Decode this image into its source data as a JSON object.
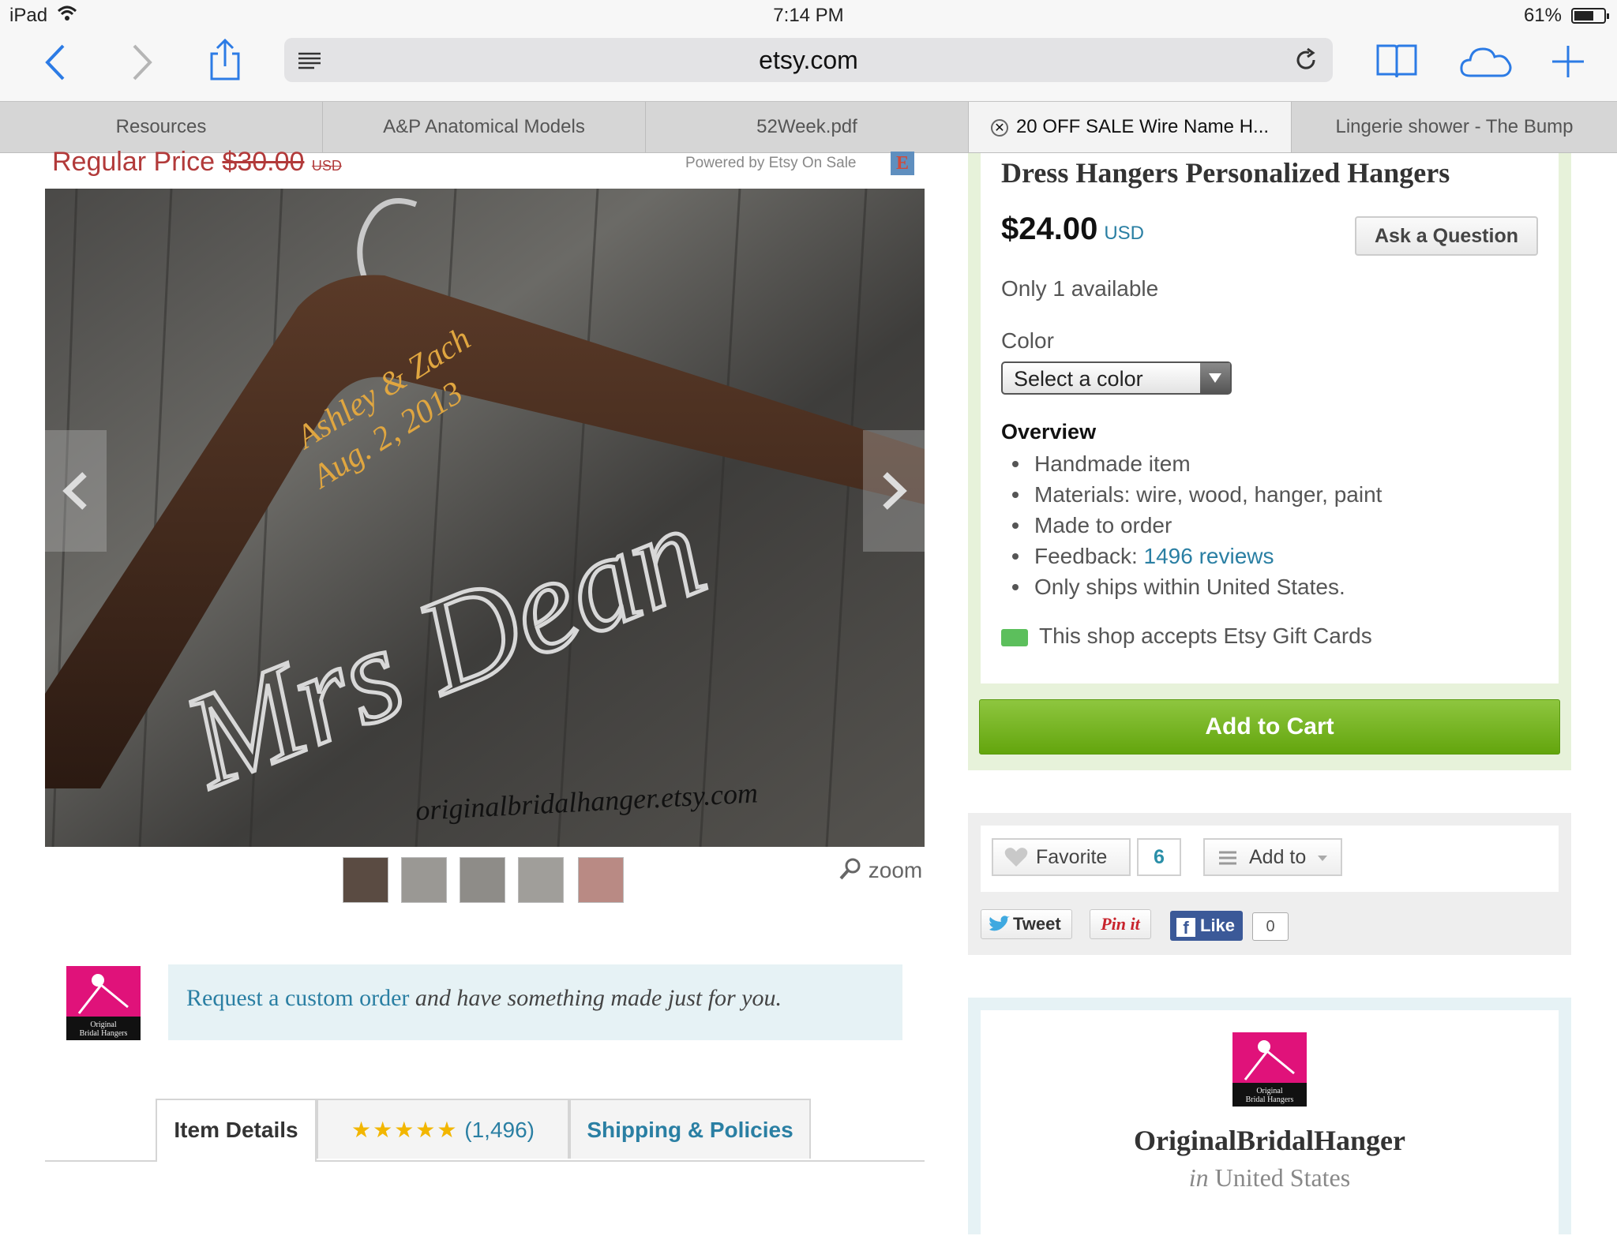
{
  "status_bar": {
    "device": "iPad",
    "time": "7:14 PM",
    "battery": "61%",
    "battery_level": 0.61
  },
  "toolbar": {
    "url": "etsy.com"
  },
  "tabs": [
    {
      "label": "Resources"
    },
    {
      "label": "A&P Anatomical Models"
    },
    {
      "label": "52Week.pdf"
    },
    {
      "label": "20 OFF SALE Wire Name H..."
    },
    {
      "label": "Lingerie shower - The Bump"
    }
  ],
  "listing": {
    "regular_price_label": "Regular Price",
    "regular_price_value": "$30.00",
    "regular_price_currency": "USD",
    "powered_by": "Powered by Etsy On Sale",
    "powered_by_logo": "E",
    "zoom_label": "zoom",
    "hero_text": {
      "names": "Ashley & Zach",
      "date": "Aug. 2, 2013",
      "wire_name": "Mrs Dean",
      "watermark": "originalbridalhanger.etsy.com"
    },
    "custom_order": {
      "link": "Request a custom order",
      "rest": " and have something made just for you."
    },
    "detail_tabs": {
      "item_details": "Item Details",
      "stars": "★★★★★",
      "reviews_count": "(1,496)",
      "rating": 5,
      "shipping": "Shipping & Policies"
    }
  },
  "buy_box": {
    "title": "Dress Hangers Personalized Hangers",
    "price": "$24.00",
    "currency": "USD",
    "ask_button": "Ask a Question",
    "availability": "Only 1 available",
    "color_label": "Color",
    "color_select_value": "Select a color",
    "overview_heading": "Overview",
    "overview_items": {
      "handmade": "Handmade item",
      "materials": "Materials: wire, wood, hanger, paint",
      "made_to_order": "Made to order",
      "feedback_label": "Feedback: ",
      "feedback_link": "1496 reviews",
      "ships": "Only ships within United States."
    },
    "gift_cards": "This shop accepts Etsy Gift Cards",
    "add_to_cart": "Add to Cart"
  },
  "social": {
    "favorite": "Favorite",
    "favorite_count": "6",
    "add_to": "Add to",
    "tweet": "Tweet",
    "pin_it": "Pin it",
    "like": "Like",
    "like_count": "0"
  },
  "shop": {
    "name": "OriginalBridalHanger",
    "location_prefix": "in",
    "location": "United States",
    "logo_text_1": "Original",
    "logo_text_2": "Bridal Hangers"
  }
}
